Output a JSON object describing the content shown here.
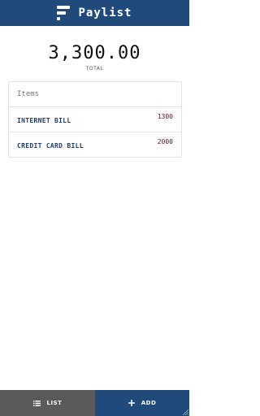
{
  "app": {
    "title": "Paylist"
  },
  "summary": {
    "total": "3,300.00",
    "total_label": "TOTAL"
  },
  "items_card": {
    "header": "Items",
    "rows": [
      {
        "name": "INTERNET BILL",
        "amount": "1300"
      },
      {
        "name": "CREDIT CARD BILL",
        "amount": "2000"
      }
    ]
  },
  "bottom_nav": {
    "list_label": "LIST",
    "list_icon": "list-icon",
    "add_label": "ADD",
    "add_icon": "plus-icon"
  },
  "colors": {
    "primary": "#1f4a7a",
    "nav_list_bg": "#5a5a5a",
    "item_name": "#1f3f6e",
    "item_amount": "#5a1a1a"
  }
}
